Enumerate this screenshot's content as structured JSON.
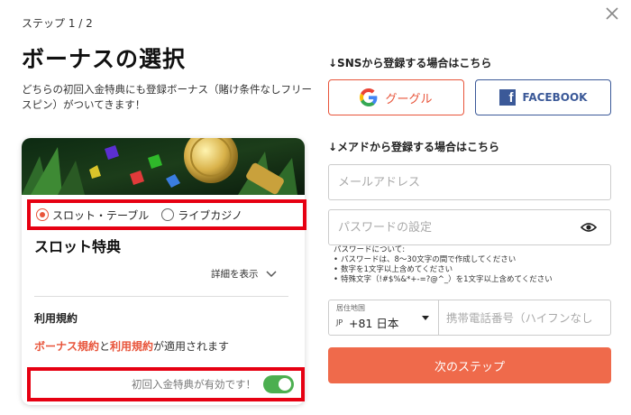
{
  "step": "ステップ 1 / 2",
  "title": "ボーナスの選択",
  "description": "どちらの初回入金特典にも登録ボーナス（賭け条件なしフリースピン）がついてきます！",
  "bonus_card": {
    "radio_options": [
      {
        "label": "スロット・テーブル",
        "selected": true
      },
      {
        "label": "ライブカジノ",
        "selected": false
      }
    ],
    "title": "スロット特典",
    "details_label": "詳細を表示",
    "terms_title": "利用規約",
    "terms_link1": "ボーナス規約",
    "terms_and": "と",
    "terms_link2": "利用規約",
    "terms_suffix": "が適用されます",
    "toggle_label": "初回入金特典が有効です！",
    "toggle_on": true
  },
  "sns": {
    "label": "↓SNSから登録する場合はこちら",
    "google_label": "グーグル",
    "facebook_label": "FACEBOOK"
  },
  "mail": {
    "label": "↓メアドから登録する場合はこちら",
    "email_placeholder": "メールアドレス",
    "password_placeholder": "パスワードの設定",
    "password_help_title": "パスワードについて:",
    "password_rules": [
      "パスワードは、8～30文字の間で作成してください",
      "数字を1文字以上含めてください",
      "特殊文字（!#$%&*+-=?@^_）を1文字以上含めてください"
    ],
    "country_label": "居住地国",
    "country_code": "JP",
    "country_value": "+81 日本",
    "phone_placeholder": "携帯電話番号（ハイフンなし"
  },
  "next_label": "次のステップ",
  "colors": {
    "accent": "#ef6a4b",
    "highlight_border": "#e60012",
    "facebook": "#3b5998",
    "toggle_on": "#4caf50"
  }
}
